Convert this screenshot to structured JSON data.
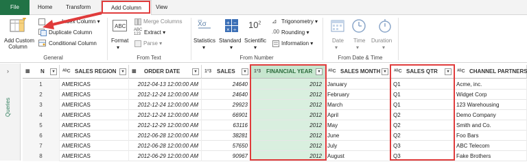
{
  "menubar": {
    "tabs": [
      "File",
      "Home",
      "Transform",
      "Add Column",
      "View"
    ]
  },
  "ribbon": {
    "general": {
      "add_custom_column": "Add Custom Column",
      "add_custom_line1": "Add Custom",
      "add_custom_line2": "Column",
      "index_column": "Index Column",
      "duplicate_column": "Duplicate Column",
      "conditional_column": "Conditional Column",
      "label": "General"
    },
    "from_text": {
      "format": "Format",
      "merge_columns": "Merge Columns",
      "extract": "Extract",
      "parse": "Parse",
      "label": "From Text"
    },
    "from_number": {
      "statistics": "Statistics",
      "standard": "Standard",
      "scientific": "Scientific",
      "trigonometry": "Trigonometry",
      "rounding": "Rounding",
      "information": "Information",
      "label": "From Number"
    },
    "from_date_time": {
      "date": "Date",
      "time": "Time",
      "duration": "Duration",
      "label": "From Date & Time"
    }
  },
  "sidepanel": {
    "label": "Queries"
  },
  "table": {
    "columns": [
      {
        "type": "1²3",
        "name": "N"
      },
      {
        "type": "A^B_C",
        "name": "SALES REGION"
      },
      {
        "type": "date-icon",
        "name": "ORDER DATE"
      },
      {
        "type": "1²3",
        "name": "SALES"
      },
      {
        "type": "1²3",
        "name": "FINANCIAL YEAR"
      },
      {
        "type": "A^B_C",
        "name": "SALES MONTH"
      },
      {
        "type": "A^B_C",
        "name": "SALES QTR"
      },
      {
        "type": "A^B_C",
        "name": "CHANNEL PARTNERS"
      }
    ],
    "rows": [
      [
        "1",
        "AMERICAS",
        "2012-04-13 12:00:00 AM",
        "24640",
        "2012",
        "January",
        "Q1",
        "Acme, inc."
      ],
      [
        "2",
        "AMERICAS",
        "2012-12-24 12:00:00 AM",
        "24640",
        "2012",
        "February",
        "Q1",
        "Widget Corp"
      ],
      [
        "3",
        "AMERICAS",
        "2012-12-24 12:00:00 AM",
        "29923",
        "2012",
        "March",
        "Q1",
        "123 Warehousing"
      ],
      [
        "4",
        "AMERICAS",
        "2012-12-24 12:00:00 AM",
        "66901",
        "2012",
        "April",
        "Q2",
        "Demo Company"
      ],
      [
        "5",
        "AMERICAS",
        "2012-12-29 12:00:00 AM",
        "63116",
        "2012",
        "May",
        "Q2",
        "Smith and Co."
      ],
      [
        "6",
        "AMERICAS",
        "2012-06-28 12:00:00 AM",
        "38281",
        "2012",
        "June",
        "Q2",
        "Foo Bars"
      ],
      [
        "7",
        "AMERICAS",
        "2012-06-28 12:00:00 AM",
        "57650",
        "2012",
        "July",
        "Q3",
        "ABC Telecom"
      ],
      [
        "8",
        "AMERICAS",
        "2012-06-29 12:00:00 AM",
        "90967",
        "2012",
        "August",
        "Q3",
        "Fake Brothers"
      ]
    ]
  },
  "colors": {
    "accent": "#217346",
    "highlight": "#e03b3b",
    "selected_column": "#d9efdf"
  }
}
